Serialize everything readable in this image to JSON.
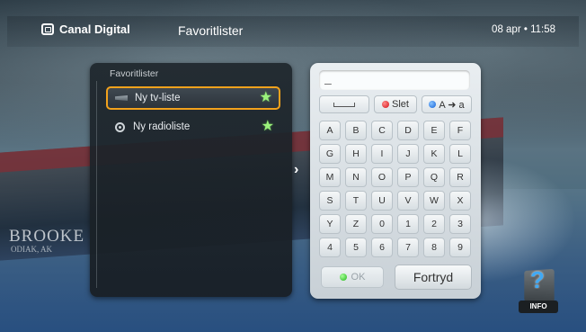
{
  "topbar": {
    "brand": "Canal Digital",
    "title": "Favoritlister",
    "datetime": "08 apr • 11:58"
  },
  "left_panel": {
    "title": "Favoritlister",
    "items": [
      {
        "label": "Ny tv-liste",
        "icon": "tv-icon",
        "selected": true,
        "star_color": "#9bf27c"
      },
      {
        "label": "Ny radioliste",
        "icon": "radio-icon",
        "selected": false,
        "star_color": "#9bf27c"
      }
    ]
  },
  "keyboard": {
    "input_value": "_",
    "delete_label": "Slet",
    "case_label": "A ➜ a",
    "rows": [
      [
        "A",
        "B",
        "C",
        "D",
        "E",
        "F"
      ],
      [
        "G",
        "H",
        "I",
        "J",
        "K",
        "L"
      ],
      [
        "M",
        "N",
        "O",
        "P",
        "Q",
        "R"
      ],
      [
        "S",
        "T",
        "U",
        "V",
        "W",
        "X"
      ],
      [
        "Y",
        "Z",
        "0",
        "1",
        "2",
        "3"
      ],
      [
        "4",
        "5",
        "6",
        "7",
        "8",
        "9"
      ]
    ],
    "ok_label": "OK",
    "cancel_label": "Fortryd"
  },
  "info": {
    "label": "INFO"
  },
  "background": {
    "boat_name": "BROOKE",
    "boat_port": "ODIAK, AK"
  },
  "colors": {
    "focus_border": "#f2a21c",
    "red_button": "#d30f16",
    "blue_button": "#1060d8",
    "green_button": "#22b51a"
  }
}
